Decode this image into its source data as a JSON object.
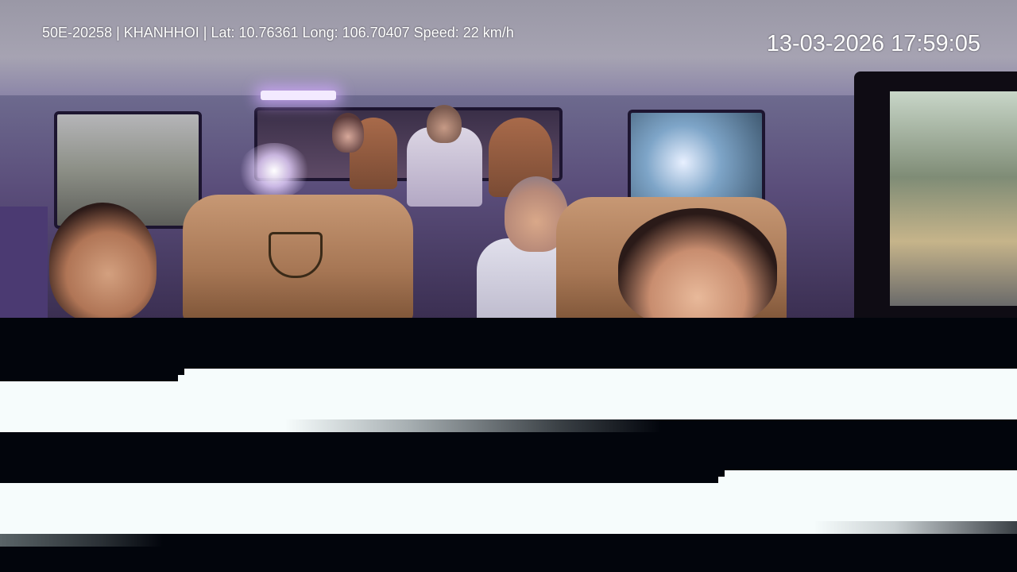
{
  "overlay": {
    "info_line": "50E-20258 | KHANHHOI | Lat: 10.76361 Long: 106.70407 Speed: 22 km/h",
    "timestamp": "13-03-2026 17:59:05"
  },
  "colors": {
    "overlay_text": "#ffffff",
    "corrupt_dark": "#02050c",
    "corrupt_light": "#f6fcfc",
    "interior_purple": "#5a4d7a"
  }
}
